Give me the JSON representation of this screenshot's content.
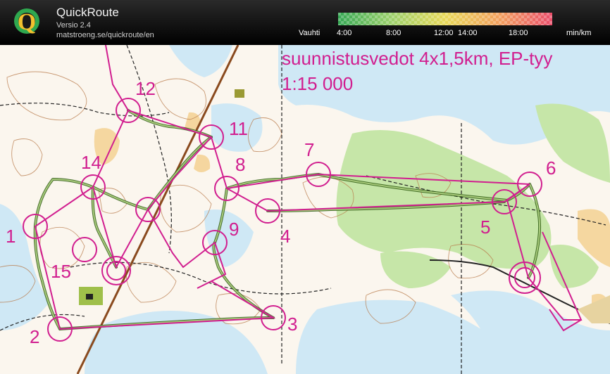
{
  "app": {
    "title": "QuickRoute",
    "version": "Versio 2.4",
    "url": "matstroeng.se/quickroute/en",
    "logo_letter": "Q"
  },
  "pace_legend": {
    "label": "Vauhti",
    "unit": "min/km",
    "ticks": [
      "4:00",
      "8:00",
      "12:00",
      "14:00",
      "18:00"
    ],
    "gradient_colors": [
      "#34a853",
      "#9cd06a",
      "#e8d857",
      "#f2a05c",
      "#ea4d6a"
    ]
  },
  "map": {
    "title": "suunnistusvedot 4x1,5km, EP-tyy",
    "scale": "1:15 000",
    "controls": [
      {
        "label": "1"
      },
      {
        "label": "2"
      },
      {
        "label": "3"
      },
      {
        "label": "4"
      },
      {
        "label": "5"
      },
      {
        "label": "6"
      },
      {
        "label": "7"
      },
      {
        "label": "8"
      },
      {
        "label": "9"
      },
      {
        "label": "11"
      },
      {
        "label": "12"
      },
      {
        "label": "14"
      },
      {
        "label": "15"
      }
    ],
    "colors": {
      "course": "#d11e8f",
      "route": "#4f7a2c",
      "water": "#cfe8f5",
      "forest": "#c6e6a8",
      "terrain": "#fbf6ee",
      "contour": "#b87a4a"
    }
  }
}
